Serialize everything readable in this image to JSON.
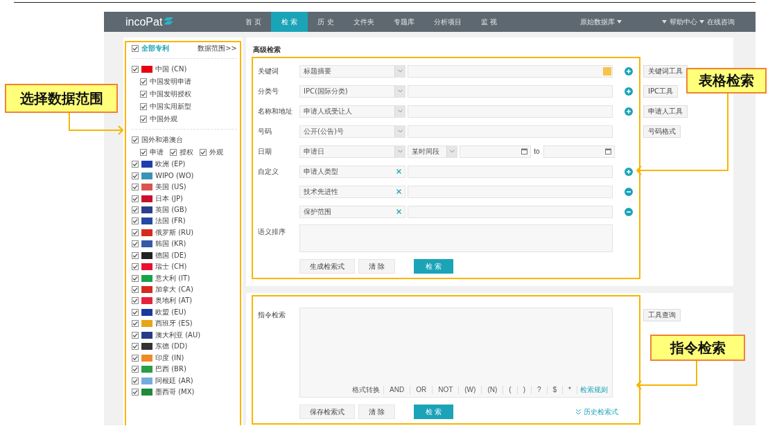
{
  "nav": {
    "logo": "incoPat",
    "items": [
      {
        "label": "首 页",
        "selected": false
      },
      {
        "label": "检 索",
        "selected": true
      },
      {
        "label": "历 史",
        "selected": false
      },
      {
        "label": "文件夹",
        "selected": false
      },
      {
        "label": "专题库",
        "selected": false
      },
      {
        "label": "分析项目",
        "selected": false
      },
      {
        "label": "监 视",
        "selected": false
      }
    ],
    "right": [
      {
        "kind": "dropdown",
        "label": "原始数据库"
      },
      {
        "kind": "caret"
      },
      {
        "kind": "dropdown",
        "label": "帮助中心"
      },
      {
        "kind": "link",
        "label": "在线咨询"
      }
    ]
  },
  "scope": {
    "all": {
      "label": "全部专利",
      "checked": true
    },
    "range_link": "数据范围>>",
    "china": {
      "label": "中国 (CN)",
      "color": "#e60012",
      "checked": true,
      "children": [
        {
          "label": "中国发明申请",
          "checked": true
        },
        {
          "label": "中国发明授权",
          "checked": true
        },
        {
          "label": "中国实用新型",
          "checked": true
        },
        {
          "label": "中国外观",
          "checked": true
        }
      ]
    },
    "foreign": {
      "label": "国外和港澳台",
      "checked": true,
      "types": [
        {
          "label": "申请",
          "checked": true
        },
        {
          "label": "授权",
          "checked": true
        },
        {
          "label": "外观",
          "checked": true
        }
      ]
    },
    "countries": [
      {
        "label": "欧洲 (EP)",
        "color": "#1f3fae",
        "checked": true
      },
      {
        "label": "WIPO (WO)",
        "color": "#3b94b8",
        "checked": true
      },
      {
        "label": "美国 (US)",
        "color": "#d9534f",
        "checked": true
      },
      {
        "label": "日本 (JP)",
        "color": "#c8102e",
        "checked": true
      },
      {
        "label": "英国 (GB)",
        "color": "#2b3f8c",
        "checked": true
      },
      {
        "label": "法国 (FR)",
        "color": "#2449a4",
        "checked": true
      },
      {
        "label": "俄罗斯 (RU)",
        "color": "#d52b1e",
        "checked": true
      },
      {
        "label": "韩国 (KR)",
        "color": "#3559a8",
        "checked": true
      },
      {
        "label": "德国 (DE)",
        "color": "#222222",
        "checked": true
      },
      {
        "label": "瑞士 (CH)",
        "color": "#e8112d",
        "checked": true
      },
      {
        "label": "意大利 (IT)",
        "color": "#16a34a",
        "checked": true
      },
      {
        "label": "加拿大 (CA)",
        "color": "#d52b1e",
        "checked": true
      },
      {
        "label": "奥地利 (AT)",
        "color": "#e4243b",
        "checked": true
      },
      {
        "label": "欧盟 (EU)",
        "color": "#1a3a9e",
        "checked": true
      },
      {
        "label": "西班牙 (ES)",
        "color": "#e8a317",
        "checked": true
      },
      {
        "label": "澳大利亚 (AU)",
        "color": "#273b8a",
        "checked": true
      },
      {
        "label": "东德 (DD)",
        "color": "#333333",
        "checked": true
      },
      {
        "label": "印度 (IN)",
        "color": "#f08a24",
        "checked": true
      },
      {
        "label": "巴西 (BR)",
        "color": "#2a9d46",
        "checked": true
      },
      {
        "label": "阿根廷 (AR)",
        "color": "#74acdf",
        "checked": true
      },
      {
        "label": "墨西哥 (MX)",
        "color": "#1e8a3a",
        "checked": true
      }
    ]
  },
  "advanced": {
    "title": "高级检索",
    "rows": [
      {
        "kind": "field",
        "label": "关键词",
        "select": "标题摘要",
        "can_add": true,
        "can_remove": false,
        "marked": true,
        "tool": "关键词工具"
      },
      {
        "kind": "field",
        "label": "分类号",
        "select": "IPC(国际分类)",
        "can_add": true,
        "can_remove": false,
        "marked": false,
        "tool": "IPC工具"
      },
      {
        "kind": "field",
        "label": "名称和地址",
        "select": "申请人或受让人",
        "can_add": true,
        "can_remove": false,
        "marked": false,
        "tool": "申请人工具"
      },
      {
        "kind": "field",
        "label": "号码",
        "select": "公开(公告)号",
        "can_add": false,
        "can_remove": false,
        "marked": false,
        "tool": "号码格式"
      },
      {
        "kind": "date",
        "label": "日期",
        "select": "申请日",
        "range": "某时间段",
        "separator": "to",
        "can_add": false,
        "can_remove": false
      },
      {
        "kind": "custom",
        "label": "自定义",
        "select": "申请人类型",
        "can_add": true,
        "can_remove": false
      },
      {
        "kind": "custom",
        "select": "技术先进性",
        "can_add": false,
        "can_remove": true
      },
      {
        "kind": "custom",
        "select": "保护范围",
        "can_add": false,
        "can_remove": true
      }
    ],
    "semantic": {
      "label": "语义排序"
    },
    "buttons": [
      {
        "label": "生成检索式",
        "kind": "default"
      },
      {
        "label": "清 除",
        "kind": "default"
      },
      {
        "label": "检 索",
        "kind": "primary"
      }
    ]
  },
  "command": {
    "label": "指令检索",
    "tool": "工具查询",
    "operators": [
      {
        "label": "格式转换",
        "kind": "format"
      },
      {
        "label": "AND",
        "kind": "op"
      },
      {
        "label": "OR",
        "kind": "op"
      },
      {
        "label": "NOT",
        "kind": "op"
      },
      {
        "label": "(W)",
        "kind": "op"
      },
      {
        "label": "(N)",
        "kind": "op"
      },
      {
        "label": "(",
        "kind": "op"
      },
      {
        "label": ")",
        "kind": "op"
      },
      {
        "label": "?",
        "kind": "op"
      },
      {
        "label": "$",
        "kind": "op"
      },
      {
        "label": "*",
        "kind": "op"
      },
      {
        "label": "检索规则",
        "kind": "link"
      }
    ],
    "buttons": [
      {
        "label": "保存检索式",
        "kind": "default"
      },
      {
        "label": "清 除",
        "kind": "default"
      },
      {
        "label": "检 索",
        "kind": "primary"
      }
    ],
    "history_link": "历史检索式"
  },
  "callouts": [
    {
      "label": "选择数据范围"
    },
    {
      "label": "表格检索"
    },
    {
      "label": "指令检索"
    }
  ]
}
